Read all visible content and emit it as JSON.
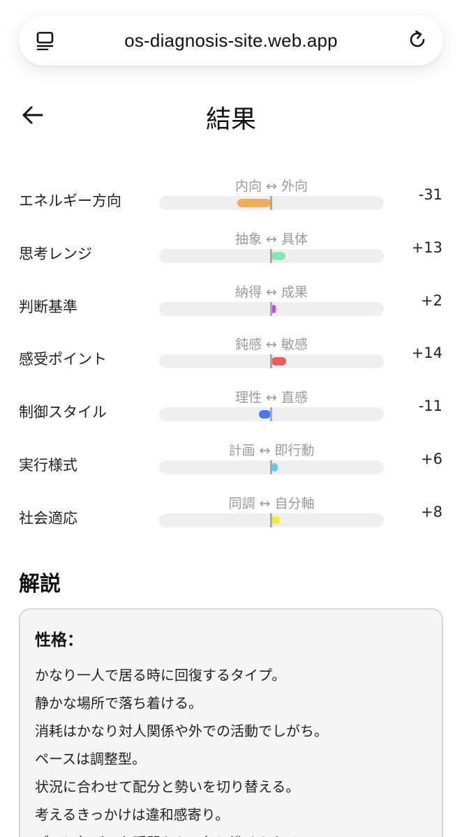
{
  "browser": {
    "url": "os-diagnosis-site.web.app",
    "tabs_icon": "tabs-icon",
    "reload_icon": "reload-icon"
  },
  "header": {
    "title": "結果",
    "back_icon": "arrow-left-icon"
  },
  "scale": {
    "min": -100,
    "max": 100
  },
  "dimensions": [
    {
      "label": "エネルギー方向",
      "axis": "内向 ↔ 外向",
      "value_text": "-31",
      "value": -31,
      "color": "#f2ad58"
    },
    {
      "label": "思考レンジ",
      "axis": "抽象 ↔ 具体",
      "value_text": "+13",
      "value": 13,
      "color": "#86e8ae"
    },
    {
      "label": "判断基準",
      "axis": "納得 ↔ 成果",
      "value_text": "+2",
      "value": 2,
      "color": "#c04be8"
    },
    {
      "label": "感受ポイント",
      "axis": "鈍感 ↔ 敏感",
      "value_text": "+14",
      "value": 14,
      "color": "#ea5b5b"
    },
    {
      "label": "制御スタイル",
      "axis": "理性 ↔ 直感",
      "value_text": "-11",
      "value": -11,
      "color": "#4a78ec"
    },
    {
      "label": "実行様式",
      "axis": "計画 ↔ 即行動",
      "value_text": "+6",
      "value": 6,
      "color": "#68c4f2"
    },
    {
      "label": "社会適応",
      "axis": "同調 ↔ 自分軸",
      "value_text": "+8",
      "value": 8,
      "color": "#f6ec2e"
    }
  ],
  "commentary": {
    "title": "解説",
    "heading": "性格：",
    "lines": [
      "かなり一人で居る時に回復するタイプ。",
      "静かな場所で落ち着ける。",
      "消耗はかなり対人関係や外での活動でしがち。",
      "ペースは調整型。",
      "状況に合わせて配分と勢いを切り替える。",
      "考えるきっかけは違和感寄り。",
      "ブレに気づいた瞬間から一気に進められる。"
    ]
  }
}
